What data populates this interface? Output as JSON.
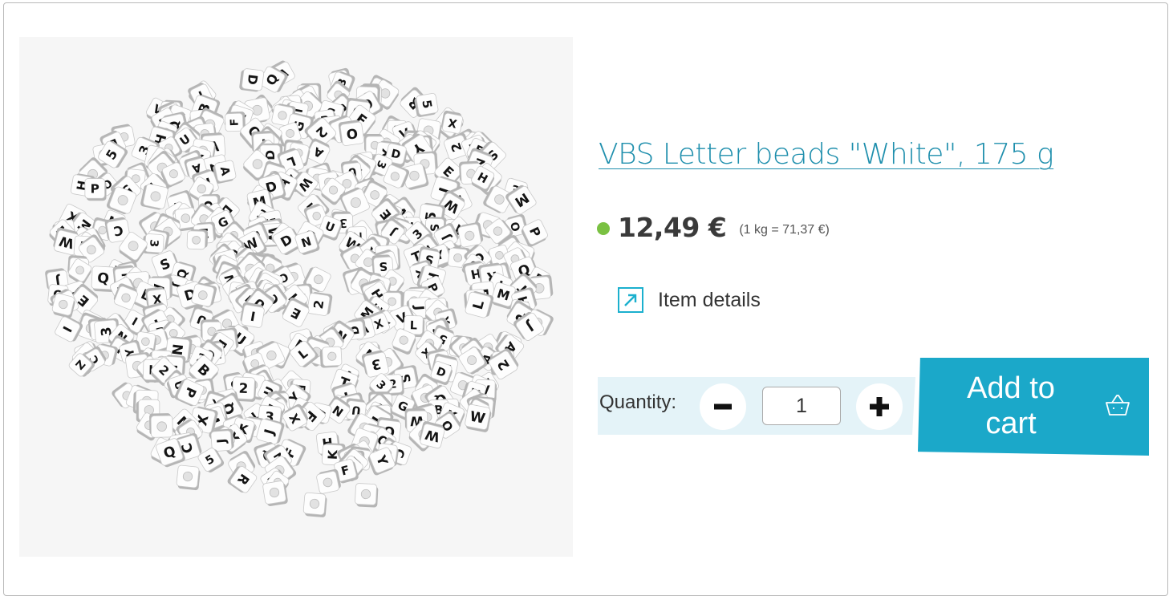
{
  "product": {
    "title": "VBS Letter beads \"White\", 175 g",
    "image_alt": "Pile of white cube letter beads",
    "bead_letters": [
      "M",
      "K",
      "P",
      "A",
      "E",
      "D",
      "X",
      "O",
      "T",
      "N",
      "Y",
      "F",
      "J",
      "L",
      "Q",
      "S",
      "H",
      "U",
      "Z",
      "R",
      "V",
      "B",
      "W",
      "C",
      "G",
      "I",
      "5",
      "3",
      "2"
    ]
  },
  "price": {
    "amount": "12,49 €",
    "unit_price": "(1 kg = 71,37 €)",
    "stock_color": "#7ac142"
  },
  "details": {
    "label": "Item details",
    "icon": "external-link-icon"
  },
  "quantity": {
    "label": "Quantity:",
    "value": "1",
    "minus_icon": "minus-icon",
    "plus_icon": "plus-icon"
  },
  "cart": {
    "label": "Add to cart",
    "icon": "basket-icon",
    "color": "#1ba8c9"
  },
  "colors": {
    "link": "#1f8fad",
    "accent": "#1ba8c9",
    "band": "#e4f3f8"
  }
}
